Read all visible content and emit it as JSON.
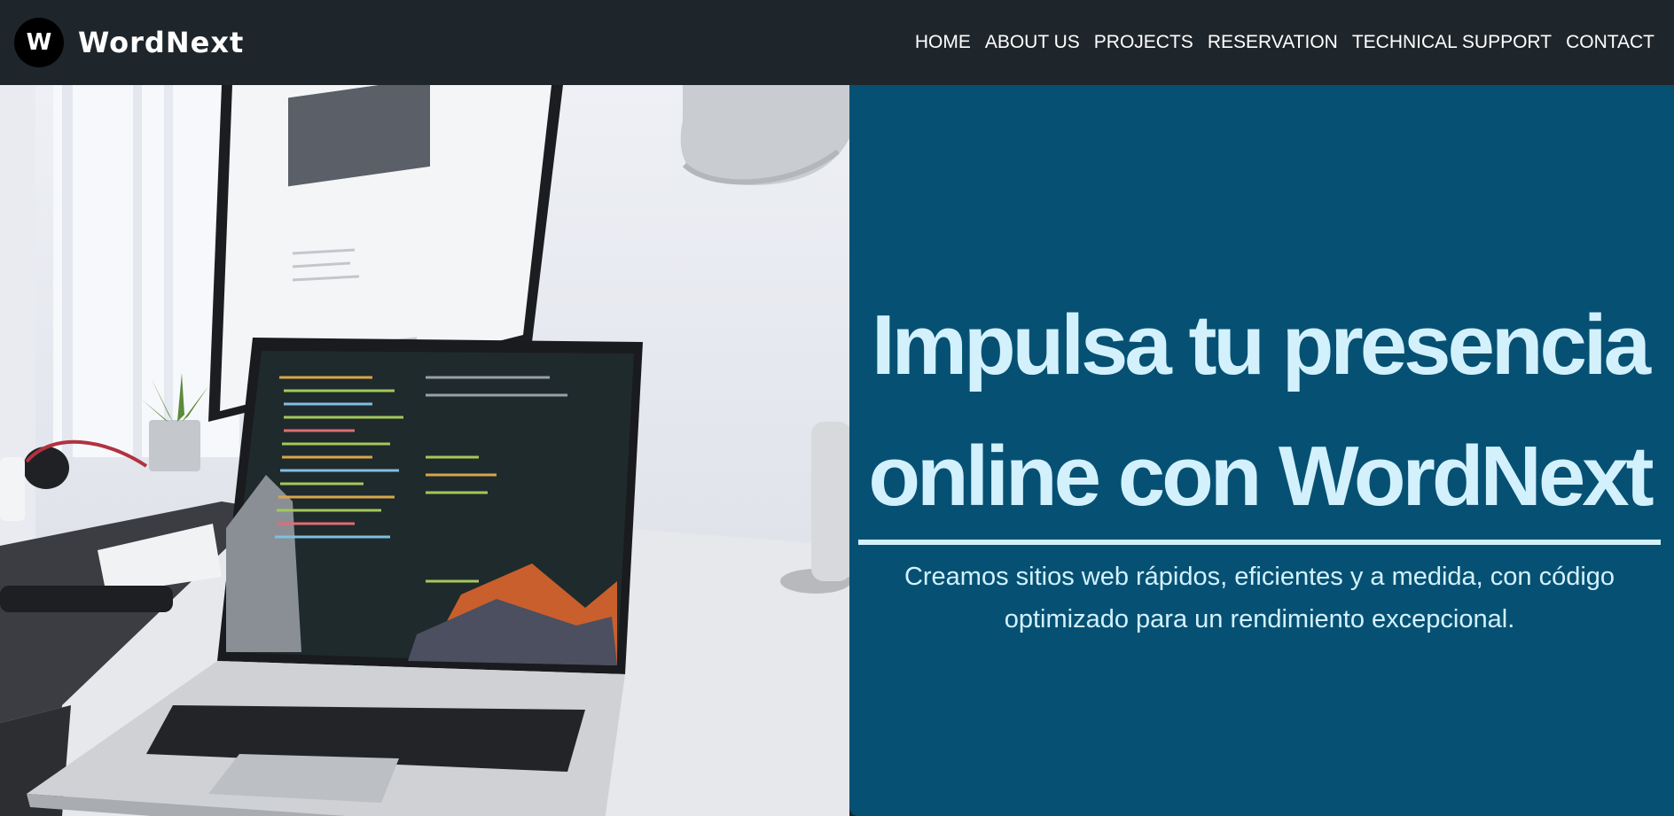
{
  "header": {
    "logo_letter": "W",
    "brand_name": "WordNext",
    "nav": [
      {
        "label": "HOME"
      },
      {
        "label": "ABOUT US"
      },
      {
        "label": "PROJECTS"
      },
      {
        "label": "RESERVATION"
      },
      {
        "label": "TECHNICAL SUPPORT"
      },
      {
        "label": "CONTACT"
      }
    ]
  },
  "hero": {
    "title": "Impulsa tu presencia online con WordNext",
    "subtitle": "Creamos sitios web rápidos, eficientes y a medida, con código optimizado para un rendimiento excepcional.",
    "image_icon": "desk-workspace-photo"
  },
  "colors": {
    "header_bg": "#1f262b",
    "panel_bg": "#065173",
    "panel_text": "#d3f1fd",
    "nav_text": "#ffffff"
  }
}
